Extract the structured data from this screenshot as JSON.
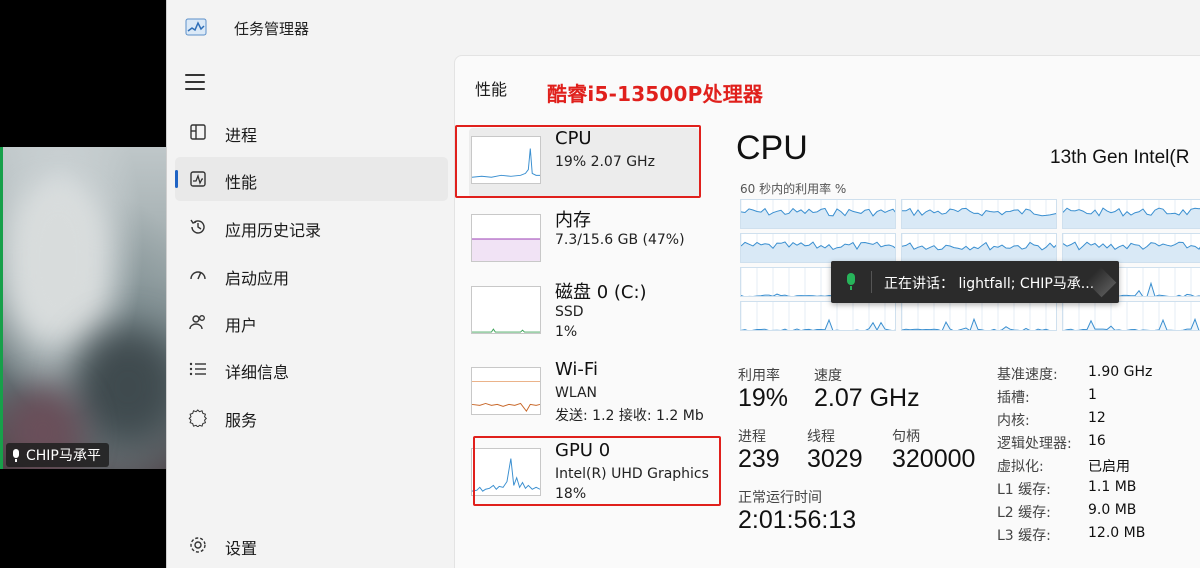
{
  "video": {
    "participant_name": "CHIP马承平"
  },
  "window": {
    "title": "任务管理器"
  },
  "nav": {
    "items": [
      {
        "label": "进程",
        "icon": "processes-icon"
      },
      {
        "label": "性能",
        "icon": "performance-icon",
        "active": true
      },
      {
        "label": "应用历史记录",
        "icon": "app-history-icon"
      },
      {
        "label": "启动应用",
        "icon": "startup-apps-icon"
      },
      {
        "label": "用户",
        "icon": "users-icon"
      },
      {
        "label": "详细信息",
        "icon": "details-icon"
      },
      {
        "label": "服务",
        "icon": "services-icon"
      }
    ],
    "settings_label": "设置"
  },
  "performance": {
    "title": "性能",
    "annotation": "酷睿i5-13500P处理器",
    "resources": [
      {
        "name": "CPU",
        "lines": [
          "19%  2.07 GHz"
        ],
        "color": "#3a8fd0"
      },
      {
        "name": "内存",
        "lines": [
          "7.3/15.6 GB (47%)"
        ],
        "color": "#9b3fb5"
      },
      {
        "name": "磁盘 0 (C:)",
        "lines": [
          "SSD",
          "1%"
        ],
        "color": "#3fa35a"
      },
      {
        "name": "Wi-Fi",
        "lines": [
          "WLAN",
          "发送: 1.2  接收: 1.2 Mb"
        ],
        "color": "#c8682a"
      },
      {
        "name": "GPU 0",
        "lines": [
          "Intel(R) UHD Graphics",
          "18%"
        ],
        "color": "#3a8fd0"
      }
    ]
  },
  "cpu_detail": {
    "heading": "CPU",
    "model": "13th Gen Intel(R",
    "graph_caption": "60 秒内的利用率 %",
    "utilization_label": "利用率",
    "utilization_value": "19%",
    "speed_label": "速度",
    "speed_value": "2.07 GHz",
    "processes_label": "进程",
    "processes_value": "239",
    "threads_label": "线程",
    "threads_value": "3029",
    "handles_label": "句柄",
    "handles_value": "320000",
    "uptime_label": "正常运行时间",
    "uptime_value": "2:01:56:13",
    "specs": [
      {
        "label": "基准速度:",
        "value": "1.90 GHz"
      },
      {
        "label": "插槽:",
        "value": "1"
      },
      {
        "label": "内核:",
        "value": "12"
      },
      {
        "label": "逻辑处理器:",
        "value": "16"
      },
      {
        "label": "虚拟化:",
        "value": "已启用"
      },
      {
        "label": "L1 缓存:",
        "value": "1.1 MB"
      },
      {
        "label": "L2 缓存:",
        "value": "9.0 MB"
      },
      {
        "label": "L3 缓存:",
        "value": "12.0 MB"
      }
    ]
  },
  "toast": {
    "text": "正在讲话： lightfall; CHIP马承..."
  },
  "colors": {
    "annotation_red": "#e0201c",
    "cpu_line": "#3a8fd0",
    "memory_line": "#9b3fb5",
    "wifi_line": "#c8682a",
    "speaking_green": "#27b45a"
  }
}
